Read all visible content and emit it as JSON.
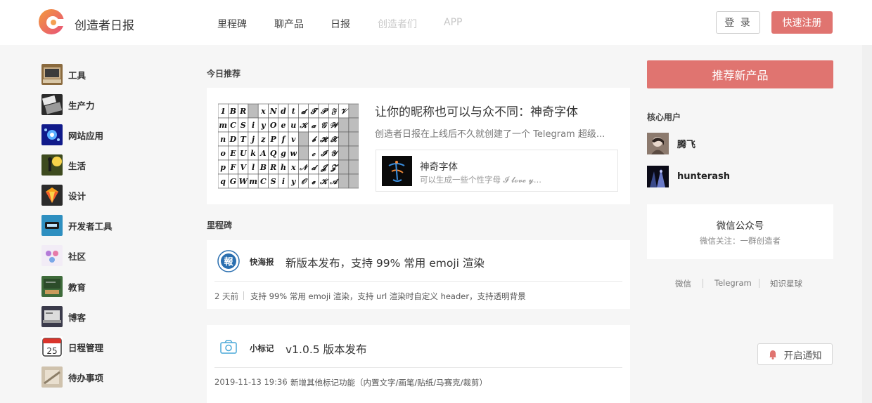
{
  "header": {
    "brand": "创造者日报",
    "nav": [
      "里程碑",
      "聊产品",
      "日报",
      "创造者们",
      "APP"
    ],
    "login": "登 录",
    "register": "快速注册"
  },
  "sidebar": {
    "items": [
      {
        "label": "工具",
        "icon": "tools-icon"
      },
      {
        "label": "生产力",
        "icon": "productivity-icon"
      },
      {
        "label": "网站应用",
        "icon": "web-apps-icon"
      },
      {
        "label": "生活",
        "icon": "life-icon"
      },
      {
        "label": "设计",
        "icon": "design-icon"
      },
      {
        "label": "开发者工具",
        "icon": "developer-tools-icon"
      },
      {
        "label": "社区",
        "icon": "community-icon"
      },
      {
        "label": "教育",
        "icon": "education-icon"
      },
      {
        "label": "博客",
        "icon": "blog-icon"
      },
      {
        "label": "日程管理",
        "icon": "calendar-icon"
      },
      {
        "label": "待办事项",
        "icon": "todo-icon"
      }
    ],
    "calendar_day": "25"
  },
  "today": {
    "section_title": "今日推荐",
    "title": "让你的昵称也可以与众不同：神奇字体",
    "desc": "创造者日报在上线后不久就创建了一个 Telegram 超级...",
    "product": {
      "name": "神奇字体",
      "desc": "可以生成一些个性字母 𝓘 𝓵𝓸𝓿𝓮 𝔂..."
    },
    "font_grid": [
      [
        "1",
        "B",
        "R",
        "▒",
        "x",
        "N",
        "d",
        "t",
        "𝓭",
        "𝓣",
        "𝒫",
        "𝔉",
        "𝒱",
        "▒"
      ],
      [
        "m",
        "C",
        "S",
        "i",
        "y",
        "O",
        "e",
        "u",
        "𝒦",
        "𝒶",
        "𝒢",
        "𝒲",
        "▒",
        "▒"
      ],
      [
        "n",
        "D",
        "T",
        "j",
        "z",
        "P",
        "f",
        "v",
        "▒",
        "𝒷",
        "𝓗",
        "𝓧",
        "▒",
        "▒"
      ],
      [
        "o",
        "E",
        "U",
        "k",
        "A",
        "Q",
        "g",
        "w",
        "▒",
        "𝒸",
        "𝓘",
        "𝒴",
        "▒",
        "▒"
      ],
      [
        "p",
        "F",
        "V",
        "l",
        "B",
        "R",
        "h",
        "x",
        "𝒩",
        "𝒹",
        "𝓙",
        "𝓩",
        "▒",
        "▒"
      ],
      [
        "q",
        "G",
        "W",
        "m",
        "C",
        "S",
        "i",
        "y",
        "𝒪",
        "𝓮",
        "𝒦",
        "𝒜",
        "▒",
        "▒"
      ]
    ]
  },
  "milestones": {
    "section_title": "里程碑",
    "items": [
      {
        "source": "快海报",
        "title": "新版本发布，支持 99% 常用 emoji 渲染",
        "time": "2 天前",
        "detail": "支持 99% 常用 emoji 渲染，支持 url 渲染时自定义 header，支持透明背景",
        "badge": "報"
      },
      {
        "source": "小标记",
        "title": "v1.0.5 版本发布",
        "time": "2019-11-13 19:36",
        "detail": "新增其他标记功能（内置文字/画笔/贴纸/马赛克/裁剪）"
      }
    ]
  },
  "right": {
    "recommend": "推荐新产品",
    "core_users_title": "核心用户",
    "users": [
      {
        "name": "腾飞"
      },
      {
        "name": "hunterash"
      }
    ],
    "wechat_title": "微信公众号",
    "wechat_sub": "微信关注：一群创造者",
    "links": [
      "微信",
      "Telegram",
      "知识星球"
    ],
    "notify": "开启通知"
  },
  "colors": {
    "accent": "#e07470",
    "logo_orange": "#f08a3a",
    "logo_pink": "#ea5a78",
    "badge_blue": "#2a6fb0"
  }
}
